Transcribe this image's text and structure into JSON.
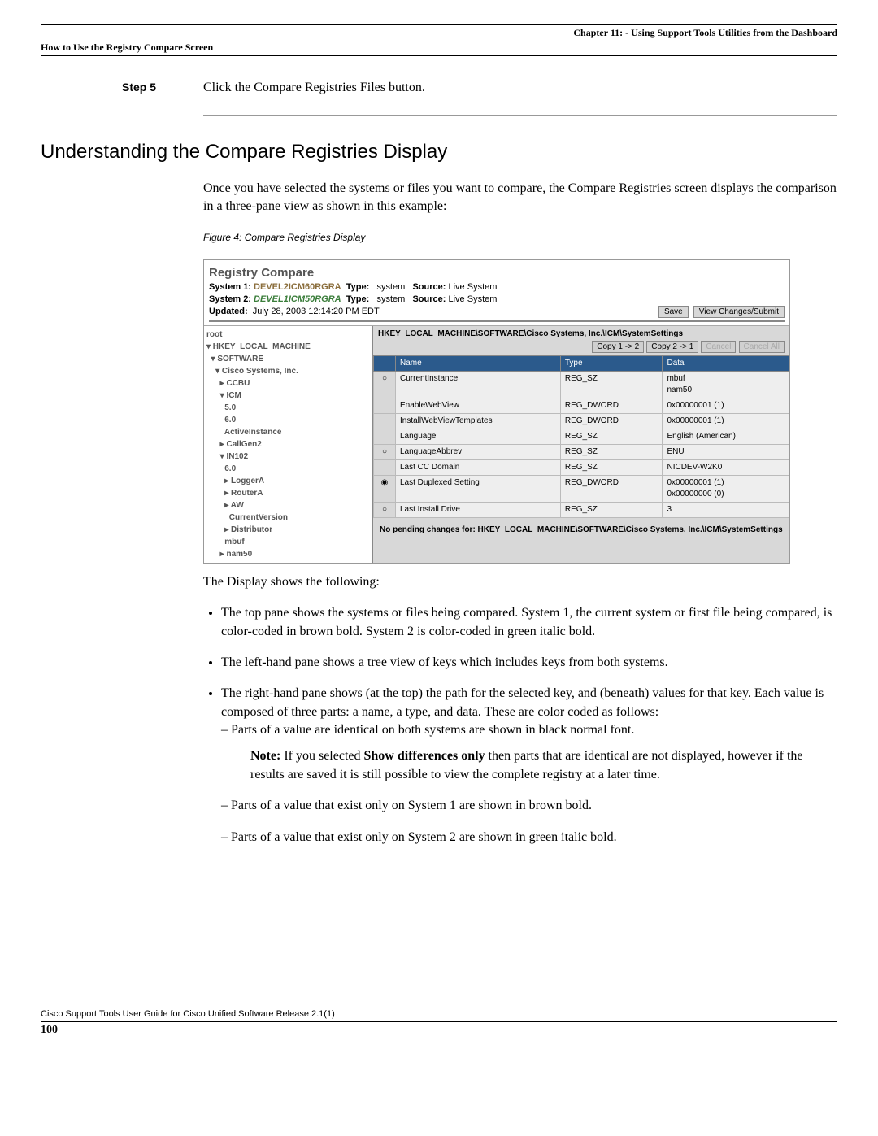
{
  "header": {
    "chapter": "Chapter 11: - Using Support Tools Utilities from the Dashboard",
    "section": "How to Use the Registry Compare Screen"
  },
  "step": {
    "label": "Step 5",
    "text": "Click the Compare Registries Files button."
  },
  "h2": "Understanding the Compare Registries Display",
  "intro": "Once you have selected the systems or files you want to compare, the Compare Registries screen displays the comparison in a three-pane view as shown in this example:",
  "figure_caption": "Figure 4: Compare Registries Display",
  "screenshot": {
    "title": "Registry Compare",
    "sys1_label": "System 1:",
    "sys1_val": "DEVEL2ICM60RGRA",
    "type_label": "Type:",
    "type_val": "system",
    "source_label": "Source:",
    "source_val": "Live System",
    "sys2_label": "System 2:",
    "sys2_val": "DEVEL1ICM50RGRA",
    "updated_label": "Updated:",
    "updated_val": "July 28, 2003 12:14:20 PM EDT",
    "btn_save": "Save",
    "btn_view": "View Changes/Submit",
    "tree": [
      "root",
      "▾ HKEY_LOCAL_MACHINE",
      "  ▾ SOFTWARE",
      "    ▾ Cisco Systems, Inc.",
      "      ▸ CCBU",
      "      ▾ ICM",
      "        5.0",
      "        6.0",
      "        ActiveInstance",
      "      ▸ CallGen2",
      "      ▾ IN102",
      "        6.0",
      "        ▸ LoggerA",
      "        ▸ RouterA",
      "        ▸ AW",
      "          CurrentVersion",
      "        ▸ Distributor",
      "        mbuf",
      "      ▸ nam50"
    ],
    "path": "HKEY_LOCAL_MACHINE\\SOFTWARE\\Cisco Systems, Inc.\\ICM\\SystemSettings",
    "btn_copy12": "Copy 1 -> 2",
    "btn_copy21": "Copy 2 -> 1",
    "btn_cancel": "Cancel",
    "btn_cancel_all": "Cancel All",
    "cols": {
      "name": "Name",
      "type": "Type",
      "data": "Data"
    },
    "rows": [
      {
        "rad": "○",
        "name": "CurrentInstance",
        "type": "REG_SZ",
        "data": "mbuf\nnam50"
      },
      {
        "rad": "",
        "name": "EnableWebView",
        "type": "REG_DWORD",
        "data": "0x00000001 (1)"
      },
      {
        "rad": "",
        "name": "InstallWebViewTemplates",
        "type": "REG_DWORD",
        "data": "0x00000001 (1)"
      },
      {
        "rad": "",
        "name": "Language",
        "type": "REG_SZ",
        "data": "English (American)"
      },
      {
        "rad": "○",
        "name": "LanguageAbbrev",
        "type": "REG_SZ",
        "data": "ENU"
      },
      {
        "rad": "",
        "name": "Last CC Domain",
        "type": "REG_SZ",
        "data": "NICDEV-W2K0"
      },
      {
        "rad": "◉",
        "name": "Last Duplexed Setting",
        "type": "REG_DWORD",
        "data": "0x00000001 (1)\n0x00000000 (0)"
      },
      {
        "rad": "○",
        "name": "Last Install Drive",
        "type": "REG_SZ",
        "data": "3"
      }
    ],
    "pending": "No pending changes for: HKEY_LOCAL_MACHINE\\SOFTWARE\\Cisco Systems, Inc.\\ICM\\SystemSettings"
  },
  "display_intro": "The Display shows the following:",
  "bullets": {
    "b1": "The top pane shows the systems or files being compared. System 1, the current system or first file being compared, is color-coded in brown bold. System 2 is color-coded in green italic bold.",
    "b2": "The left-hand pane shows a tree view of keys which includes keys from both systems.",
    "b3": "The right-hand pane shows (at the top) the path for the selected key, and (beneath) values for that key. Each value is composed of three parts: a name, a type, and data. These are color coded as follows:",
    "s1": "Parts of a value are identical on both systems are shown in black normal font.",
    "note_label": "Note:",
    "note_rest": " If you selected ",
    "note_bold": "Show differences only",
    "note_tail": " then parts that are identical are not displayed, however if the results are saved it is still possible to view the complete registry at a later time.",
    "s2": "Parts of a value that exist only on System 1 are shown in brown bold.",
    "s3": "Parts of a value that exist only on System 2 are shown in green italic bold."
  },
  "footer": {
    "book": "Cisco Support Tools User Guide for Cisco Unified Software Release 2.1(1)",
    "page": "100"
  }
}
